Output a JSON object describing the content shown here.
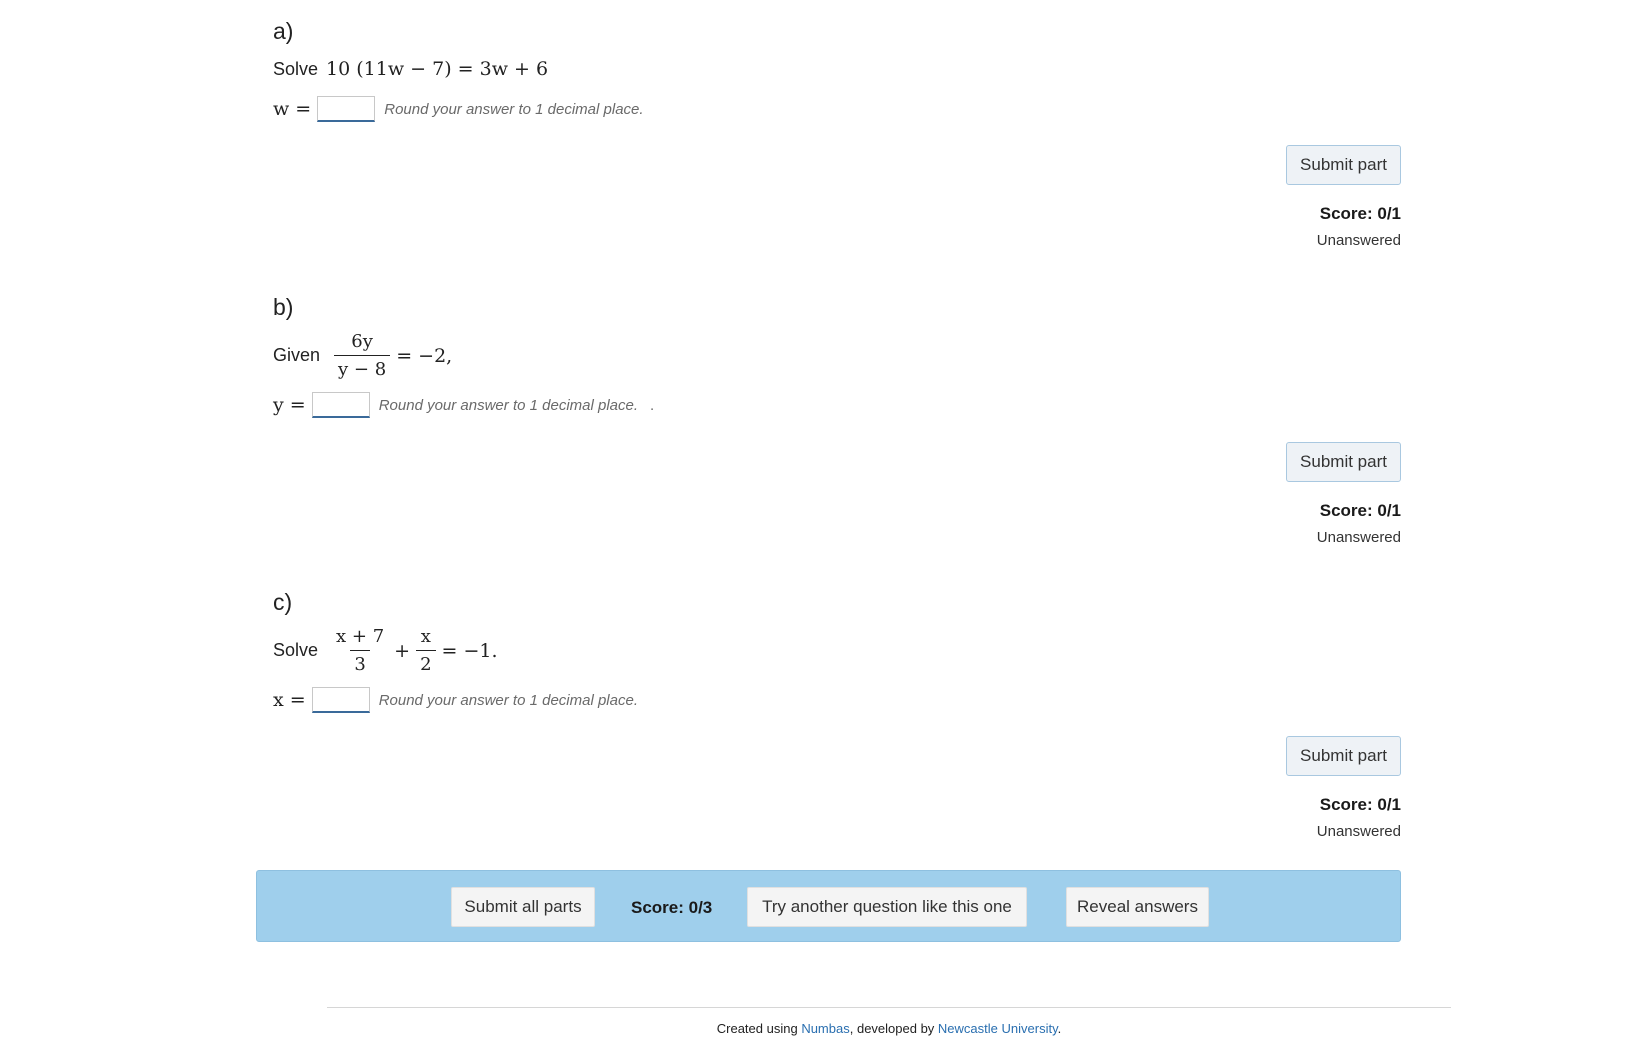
{
  "parts": [
    {
      "label": "a)",
      "prompt_word": "Solve",
      "equation": "10 (11w − 7) = 3w + 6",
      "variable": "w =",
      "answer_value": "",
      "hint": "Round your answer to 1 decimal place.",
      "submit_label": "Submit part",
      "score": "Score: 0/1",
      "status": "Unanswered"
    },
    {
      "label": "b)",
      "prompt_word": "Given",
      "fraction_num": "6y",
      "fraction_den": "y − 8",
      "equation_rest": "= −2,",
      "variable": "y =",
      "answer_value": "",
      "hint": "Round your answer to 1 decimal place.",
      "trailing": ".",
      "submit_label": "Submit part",
      "score": "Score: 0/1",
      "status": "Unanswered"
    },
    {
      "label": "c)",
      "prompt_word": "Solve",
      "fraction1_num": "x + 7",
      "fraction1_den": "3",
      "plus": "+",
      "fraction2_num": "x",
      "fraction2_den": "2",
      "equation_rest": "= −1.",
      "variable": "x =",
      "answer_value": "",
      "hint": "Round your answer to 1 decimal place.",
      "submit_label": "Submit part",
      "score": "Score: 0/1",
      "status": "Unanswered"
    }
  ],
  "bottom_bar": {
    "submit_all_label": "Submit all parts",
    "score": "Score: 0/3",
    "try_another_label": "Try another question like this one",
    "reveal_label": "Reveal answers",
    "background_color": "#9fcfec"
  },
  "footer": {
    "prefix": "Created using ",
    "numbas_link": "Numbas",
    "middle": ", developed by ",
    "university_link": "Newcastle University",
    "suffix": ".",
    "link_color": "#2a6fb0"
  }
}
